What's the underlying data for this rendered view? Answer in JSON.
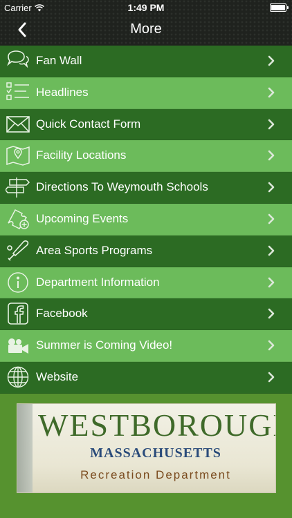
{
  "status_bar": {
    "carrier": "Carrier",
    "time": "1:49 PM",
    "icons": [
      "wifi-icon",
      "battery-icon"
    ]
  },
  "nav": {
    "title": "More",
    "back_icon": "chevron-left-icon"
  },
  "menu": {
    "items": [
      {
        "label": "Fan Wall",
        "icon": "speech-bubbles-icon"
      },
      {
        "label": "Headlines",
        "icon": "checklist-icon"
      },
      {
        "label": "Quick Contact Form",
        "icon": "envelope-icon"
      },
      {
        "label": "Facility Locations",
        "icon": "map-pin-icon"
      },
      {
        "label": "Directions To Weymouth Schools",
        "icon": "signpost-icon"
      },
      {
        "label": "Upcoming Events",
        "icon": "ticket-add-icon"
      },
      {
        "label": "Area Sports Programs",
        "icon": "baseball-bat-icon"
      },
      {
        "label": "Department Information",
        "icon": "info-icon"
      },
      {
        "label": "Facebook",
        "icon": "facebook-icon"
      },
      {
        "label": "Summer is Coming Video!",
        "icon": "video-camera-icon"
      },
      {
        "label": "Website",
        "icon": "globe-icon"
      }
    ],
    "chevron_icon": "chevron-right-icon"
  },
  "banner": {
    "line1": "WESTBOROUGH",
    "line2": "MASSACHUSETTS",
    "line3": "Recreation Department"
  },
  "colors": {
    "row_dark": "#2c6b23",
    "row_light": "#6cbb5b",
    "background": "#56922f",
    "nav_bar": "#1f221e"
  }
}
